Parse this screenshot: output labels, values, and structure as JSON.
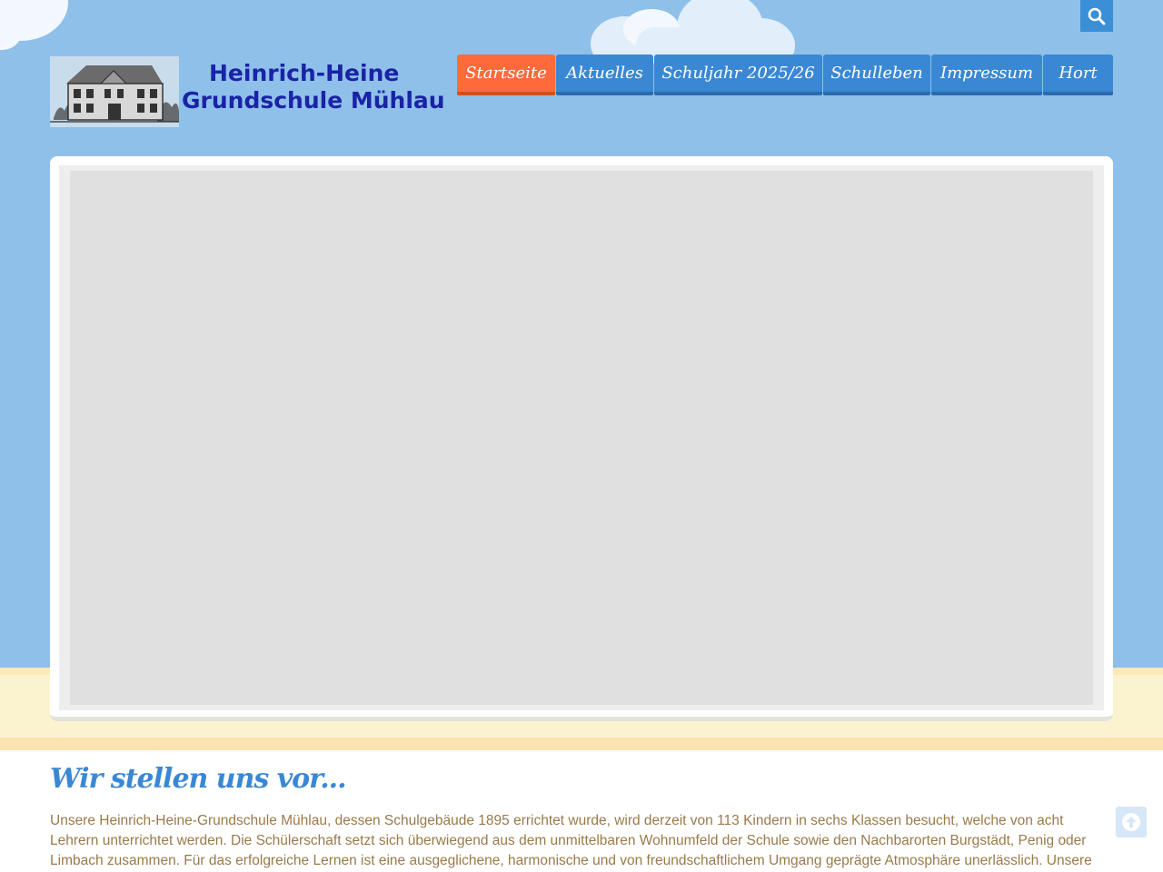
{
  "header": {
    "logo_line1": "Heinrich-Heine",
    "logo_line2": "Grundschule Mühlau"
  },
  "nav": {
    "items": [
      {
        "label": "Startseite",
        "active": true
      },
      {
        "label": "Aktuelles",
        "active": false
      },
      {
        "label": "Schuljahr 2025/26",
        "active": false
      },
      {
        "label": "Schulleben",
        "active": false
      },
      {
        "label": "Impressum",
        "active": false
      },
      {
        "label": "Hort",
        "active": false
      }
    ]
  },
  "icons": {
    "search": "search-icon",
    "scroll_top": "arrow-up-icon",
    "logo_image": "school-building-icon"
  },
  "content": {
    "heading": "Wir stellen uns vor...",
    "paragraph": "Unsere Heinrich-Heine-Grundschule Mühlau, dessen Schulgebäude 1895 errichtet wurde, wird derzeit von 113 Kindern in sechs Klassen besucht, welche von acht Lehrern unterrichtet werden. Die Schülerschaft setzt sich überwiegend aus dem unmittelbaren Wohnumfeld der Schule sowie den Nachbarorten Burgstädt, Penig oder Limbach zusammen. Für das erfolgreiche Lernen ist eine ausgeglichene, harmonische und von freundschaftlichem Umgang geprägte Atmosphäre unerlässlich. Unsere"
  },
  "colors": {
    "sky": "#8fc0ea",
    "nav_blue": "#3a88d4",
    "nav_active": "#fe6a3b",
    "logo_text": "#1a23a6",
    "body_text": "#9a7a4a",
    "sand": "#fbf2d0"
  }
}
